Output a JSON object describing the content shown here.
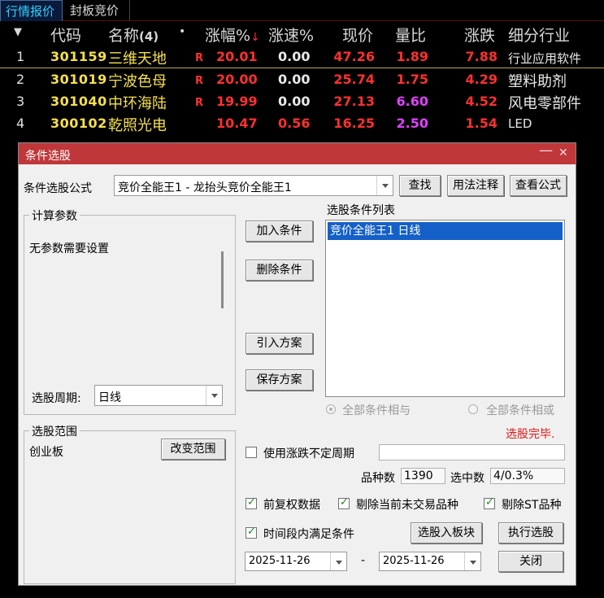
{
  "tabs": [
    "行情报价",
    "封板竞价"
  ],
  "table": {
    "headers": {
      "code": "代码",
      "name": "名称",
      "count": "(4)",
      "dot": "•",
      "chg": "涨幅%",
      "sort_arrow": "↓",
      "speed": "涨速%",
      "price": "现价",
      "vol_ratio": "量比",
      "rise": "涨跌",
      "industry": "细分行业"
    },
    "rows": [
      {
        "idx": "1",
        "code": "301159",
        "name": "三维天地",
        "flag": "R",
        "chg": "20.01",
        "speed": "0.00",
        "price": "47.26",
        "vol_ratio": "1.89",
        "rise": "7.88",
        "industry": "行业应用软件"
      },
      {
        "idx": "2",
        "code": "301019",
        "name": "宁波色母",
        "flag": "R",
        "chg": "20.00",
        "speed": "0.00",
        "price": "25.74",
        "vol_ratio": "1.75",
        "rise": "4.29",
        "industry": "塑料助剂"
      },
      {
        "idx": "3",
        "code": "301040",
        "name": "中环海陆",
        "flag": "R",
        "chg": "19.99",
        "speed": "0.00",
        "price": "27.13",
        "vol_ratio": "6.60",
        "rise": "4.52",
        "industry": "风电零部件"
      },
      {
        "idx": "4",
        "code": "300102",
        "name": "乾照光电",
        "flag": "",
        "chg": "10.47",
        "speed": "0.56",
        "price": "16.25",
        "vol_ratio": "2.50",
        "rise": "1.54",
        "industry": "LED"
      }
    ]
  },
  "dialog": {
    "title": "条件选股",
    "controls": {
      "minimize": "—",
      "close": "✕"
    },
    "formula_label": "条件选股公式",
    "formula_value": "竞价全能王1  -  龙抬头竞价全能王1",
    "buttons": {
      "find": "查找",
      "usage": "用法注释",
      "view": "查看公式",
      "add": "加入条件",
      "delete": "删除条件",
      "import": "引入方案",
      "save": "保存方案",
      "change_range": "改变范围",
      "to_block": "选股入板块",
      "execute": "执行选股",
      "close": "关闭"
    },
    "params_group": "计算参数",
    "params_text": "无参数需要设置",
    "period_label": "选股周期:",
    "period_value": "日线",
    "cond_list_label": "选股条件列表",
    "cond_items": [
      "竞价全能王1  日线"
    ],
    "radio_and": "全部条件相与",
    "radio_or": "全部条件相或",
    "status": "选股完毕.",
    "range_group": "选股范围",
    "range_value": "创业板",
    "use_period_label": "使用涨跌不定周期",
    "count_label": "品种数",
    "count_value": "1390",
    "selected_label": "选中数",
    "selected_value": "4/0.3%",
    "cb_fq": "前复权数据",
    "cb_untraded": "剔除当前未交易品种",
    "cb_st": "剔除ST品种",
    "cb_period": "时间段内满足条件",
    "date_from": "2025-11-26",
    "date_sep": "-",
    "date_to": "2025-11-26"
  }
}
